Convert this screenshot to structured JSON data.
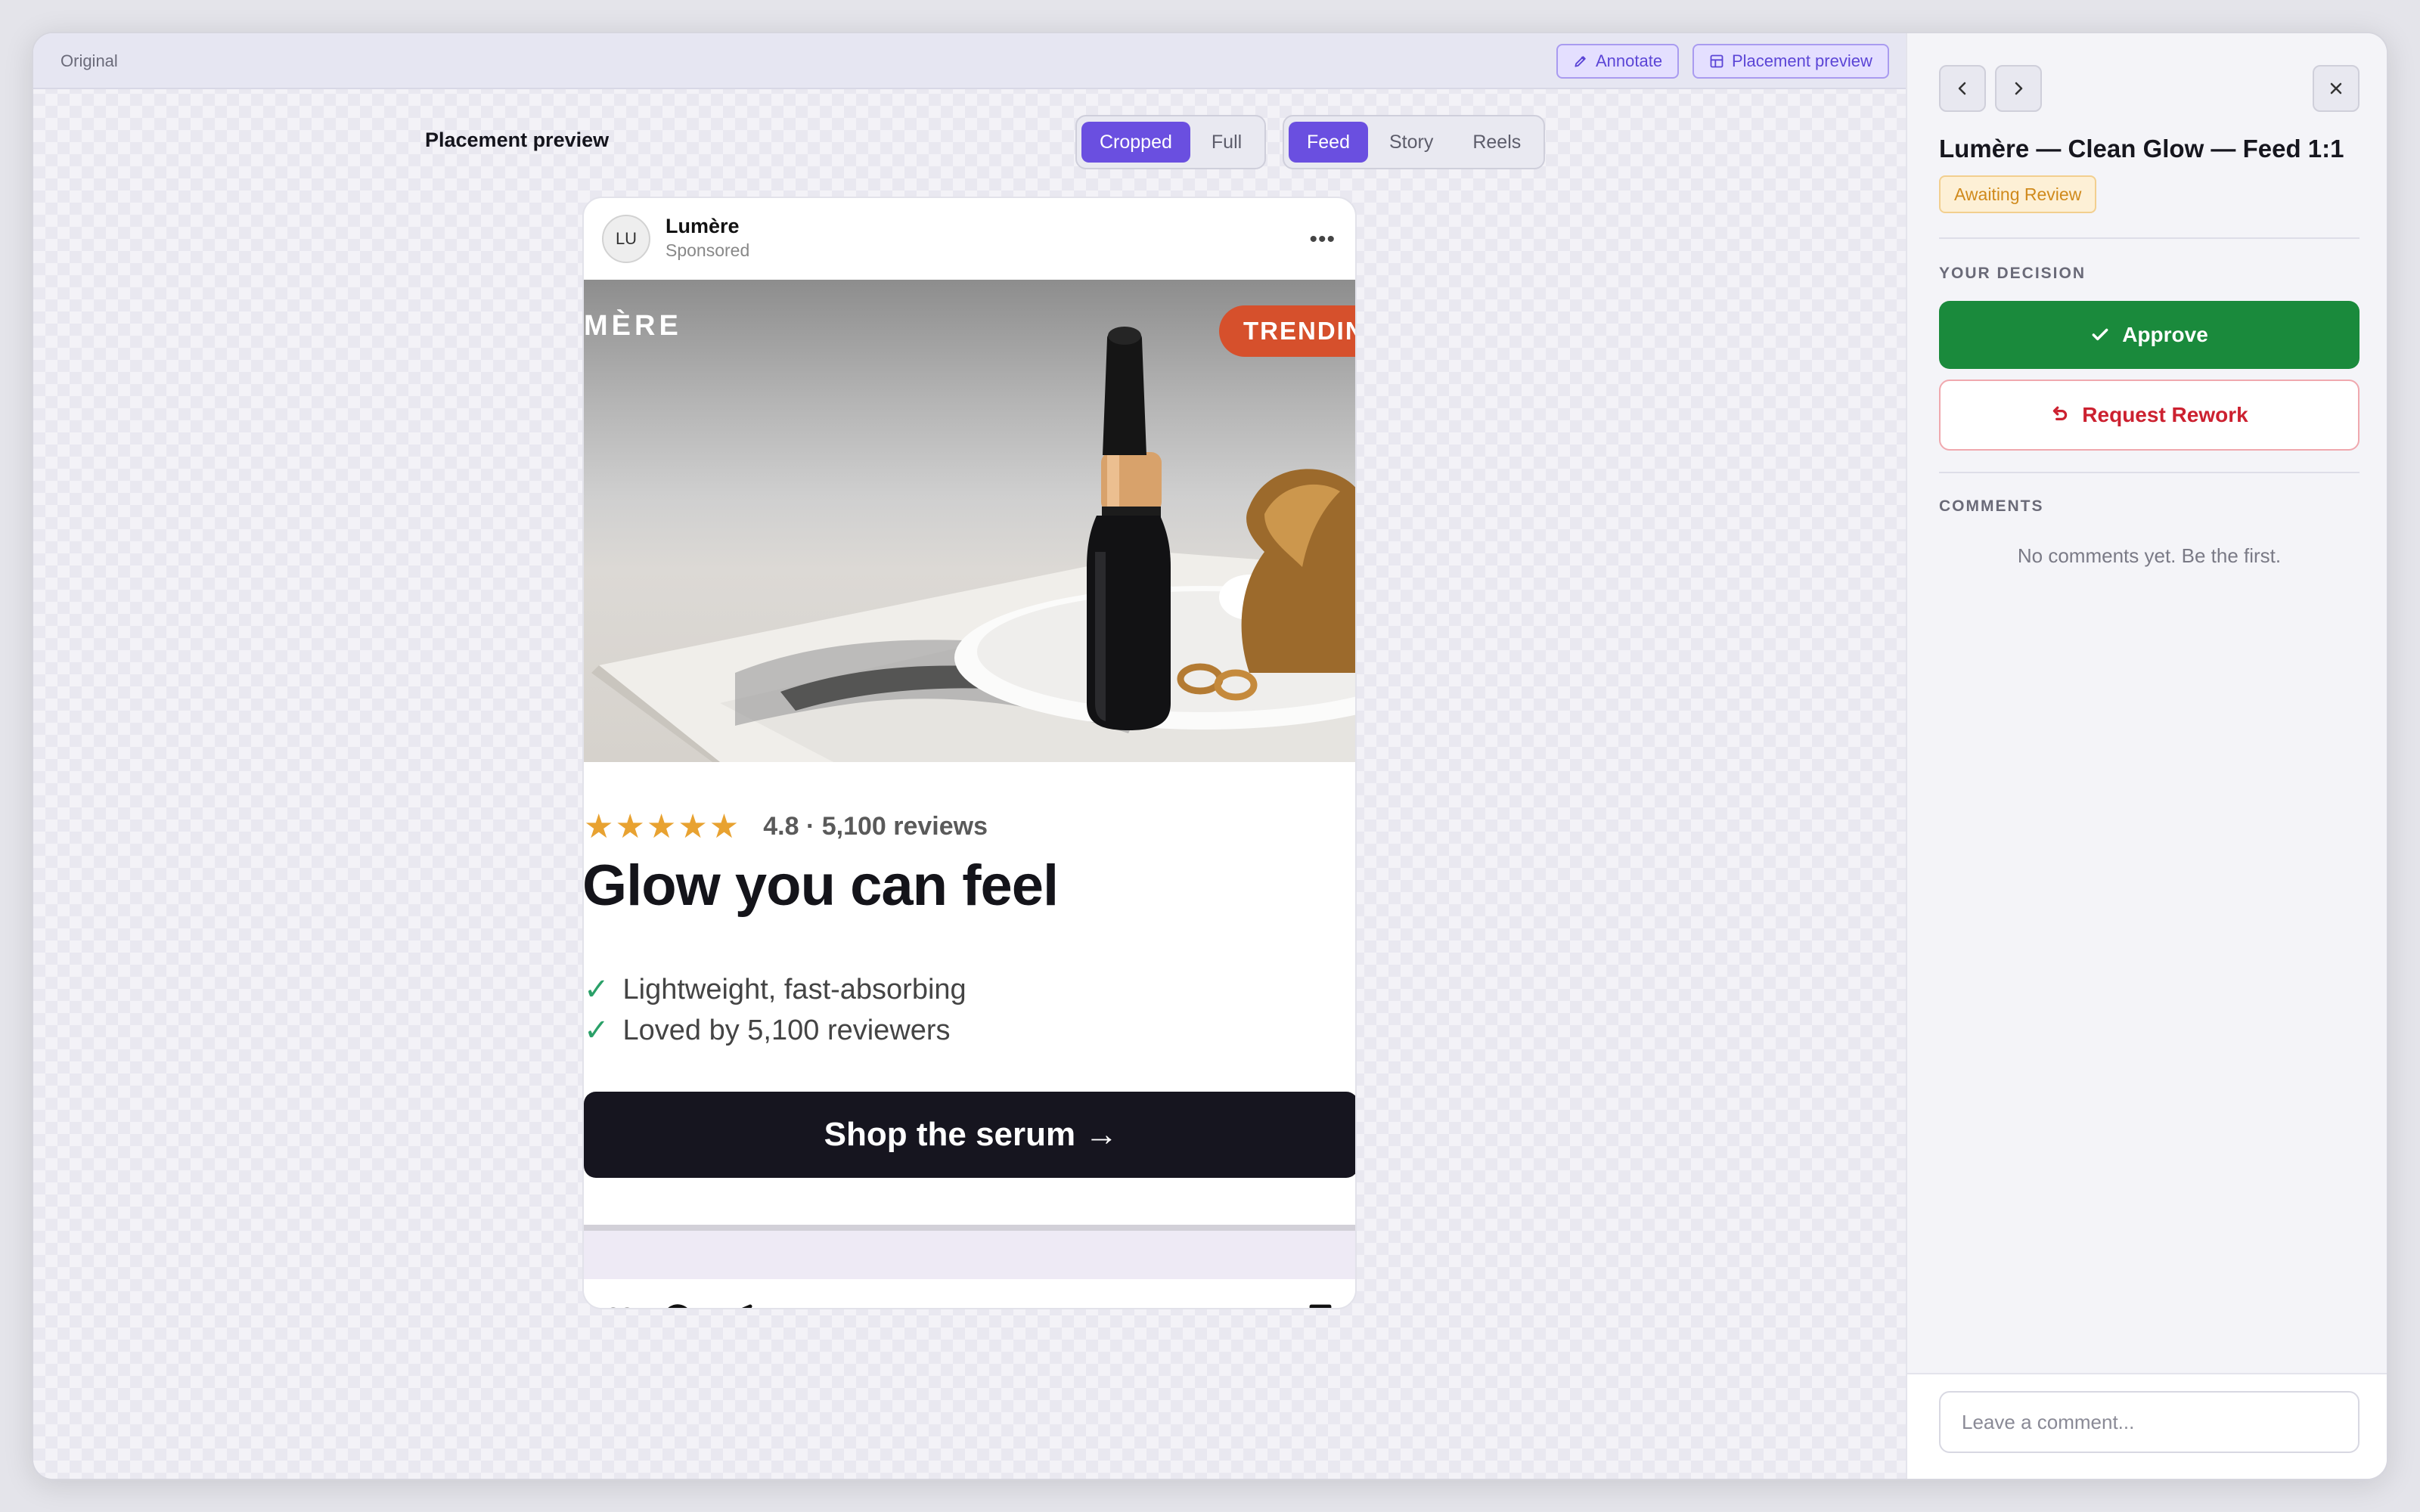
{
  "toolbar": {
    "original_label": "Original",
    "annotate_label": "Annotate",
    "placement_preview_label": "Placement preview"
  },
  "preview": {
    "title": "Placement preview",
    "crop_options": [
      {
        "label": "Cropped",
        "active": true
      },
      {
        "label": "Full",
        "active": false
      }
    ],
    "placement_options": [
      {
        "label": "Feed",
        "active": true
      },
      {
        "label": "Story",
        "active": false
      },
      {
        "label": "Reels",
        "active": false
      }
    ]
  },
  "post": {
    "avatar_initials": "LU",
    "brand": "Lumère",
    "sponsored": "Sponsored",
    "more_icon": "more-horizontal-icon",
    "image": {
      "brand_text": "MÈRE",
      "badge_text": "TRENDIN"
    },
    "stars": "★★★★★",
    "rating_text": "4.8 · 5,100 reviews",
    "headline": "Glow you can feel",
    "bullets": [
      {
        "check": "✓",
        "text": "Lightweight, fast-absorbing"
      },
      {
        "check": "✓",
        "text": "Loved by 5,100 reviewers"
      }
    ],
    "cta": "Shop the serum →",
    "action_icons": [
      "heart-icon",
      "comment-icon",
      "send-icon",
      "bookmark-icon"
    ]
  },
  "panel": {
    "title": "Lumère — Clean Glow — Feed 1:1",
    "status": "Awaiting Review",
    "decision_label": "YOUR DECISION",
    "approve_label": "Approve",
    "rework_label": "Request Rework",
    "comments_label": "COMMENTS",
    "no_comments": "No comments yet. Be the first.",
    "comment_placeholder": "Leave a comment..."
  },
  "colors": {
    "accent": "#6a4fe0",
    "approve": "#1a8a3c",
    "rework": "#cc2130",
    "status_text": "#d08a1c",
    "badge": "#d6502c",
    "star": "#e8a231",
    "check": "#2aa068"
  }
}
